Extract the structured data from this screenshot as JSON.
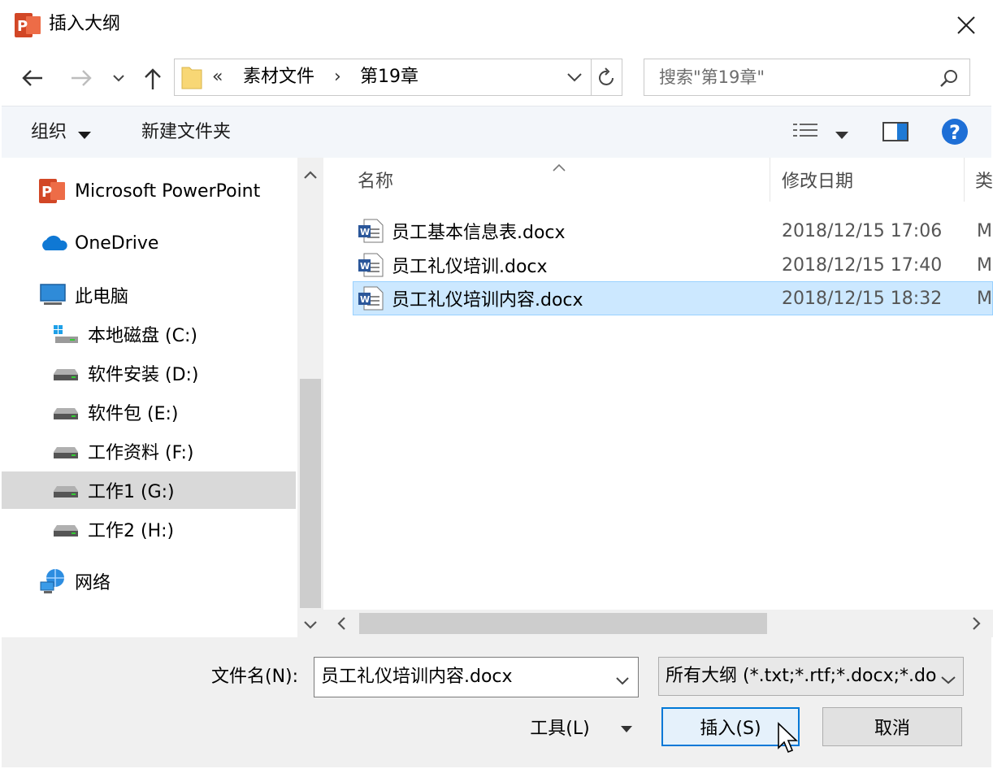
{
  "window": {
    "title": "插入大纲",
    "app_icon": "powerpoint-icon",
    "close_icon": "close-icon"
  },
  "nav": {
    "back_icon": "back-arrow-icon",
    "forward_icon": "forward-arrow-icon",
    "recent_icon": "chevron-down-icon",
    "up_icon": "up-arrow-icon",
    "path_overflow": "«",
    "breadcrumbs": [
      "素材文件",
      "第19章"
    ],
    "refresh_icon": "refresh-icon",
    "search_placeholder": "搜索\"第19章\""
  },
  "toolbar": {
    "organize_label": "组织",
    "new_folder_label": "新建文件夹",
    "view_icon": "view-options-icon",
    "preview_icon": "preview-pane-icon",
    "help_icon": "help-icon"
  },
  "sidebar": {
    "items": [
      {
        "label": "Microsoft PowerPoint",
        "icon": "powerpoint-icon"
      },
      {
        "label": "OneDrive",
        "icon": "cloud-icon"
      },
      {
        "label": "此电脑",
        "icon": "computer-icon"
      },
      {
        "label": "本地磁盘 (C:)",
        "icon": "windows-drive-icon"
      },
      {
        "label": "软件安装 (D:)",
        "icon": "drive-icon"
      },
      {
        "label": "软件包 (E:)",
        "icon": "drive-icon"
      },
      {
        "label": "工作资料 (F:)",
        "icon": "drive-icon"
      },
      {
        "label": "工作1 (G:)",
        "icon": "drive-icon",
        "selected": true
      },
      {
        "label": "工作2 (H:)",
        "icon": "drive-icon"
      },
      {
        "label": "网络",
        "icon": "network-icon"
      }
    ]
  },
  "files": {
    "columns": [
      "名称",
      "修改日期",
      "类"
    ],
    "rows": [
      {
        "name": "员工基本信息表.docx",
        "modified": "2018/12/15  17:06",
        "type": "M"
      },
      {
        "name": "员工礼仪培训.docx",
        "modified": "2018/12/15  17:40",
        "type": "M"
      },
      {
        "name": "员工礼仪培训内容.docx",
        "modified": "2018/12/15  18:32",
        "type": "M",
        "selected": true
      }
    ]
  },
  "footer": {
    "filename_label": "文件名(N):",
    "filename_value": "员工礼仪培训内容.docx",
    "filter_value": "所有大纲 (*.txt;*.rtf;*.docx;*.do",
    "tools_label": "工具(L)",
    "insert_label": "插入(S)",
    "cancel_label": "取消"
  },
  "colors": {
    "accent": "#0078d7",
    "selection": "#cce8ff",
    "powerpoint": "#d24726",
    "word": "#2b579a"
  }
}
